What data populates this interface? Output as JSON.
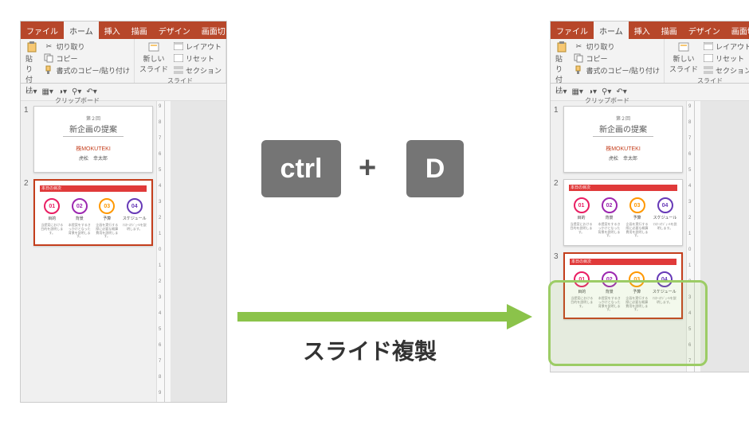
{
  "tabs": {
    "file": "ファイル",
    "home": "ホーム",
    "insert": "挿入",
    "draw": "描画",
    "design": "デザイン",
    "transition": "画面切り替え"
  },
  "ribbon": {
    "clipboard": {
      "paste": "貼り付け",
      "cut": "切り取り",
      "copy": "コピー",
      "format": "書式のコピー/貼り付け",
      "label": "クリップボード"
    },
    "slides": {
      "new": "新しい\nスライド",
      "layout": "レイアウト",
      "reset": "リセット",
      "section": "セクション",
      "label": "スライド"
    }
  },
  "slide1": {
    "small": "第２回",
    "title": "新企画の提案",
    "logo": "株MOKUTEKI",
    "author": "虎松　幸太郎"
  },
  "agenda": {
    "bar": "本日の目次",
    "items": [
      {
        "num": "01",
        "label": "目的",
        "txt": "当提案における目的を説明します。"
      },
      {
        "num": "02",
        "label": "背景",
        "txt": "本提案をするきっかけとなった背景を説明します。"
      },
      {
        "num": "03",
        "label": "予算",
        "txt": "企画を実行する際に必要な概算費用を説明します。"
      },
      {
        "num": "04",
        "label": "スケジュール",
        "txt": "ﾏｽﾀｰｽｹｼﾞｭｰﾙを説明します。"
      }
    ]
  },
  "thumbnails": {
    "n1": "1",
    "n2": "2",
    "n3": "3"
  },
  "keys": {
    "ctrl": "ctrl",
    "plus": "+",
    "d": "D"
  },
  "caption": "スライド複製",
  "ruler": {
    "v": [
      "9",
      "8",
      "7",
      "6",
      "5",
      "4",
      "3",
      "2",
      "1",
      "0",
      "1",
      "2",
      "3",
      "4",
      "5",
      "6",
      "7",
      "8",
      "9"
    ]
  }
}
